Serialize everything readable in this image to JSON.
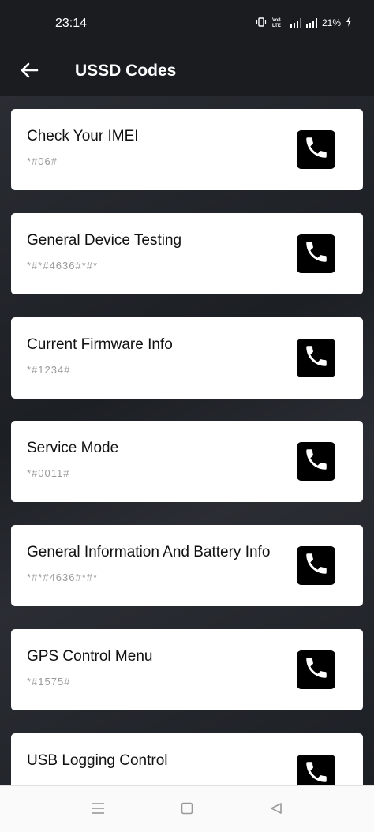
{
  "status_bar": {
    "time": "23:14",
    "volte_label": "Vo8\nLTE",
    "battery": "21%"
  },
  "app_bar": {
    "title": "USSD Codes",
    "back_icon": "arrow-left-icon"
  },
  "codes": [
    {
      "title": "Check Your IMEI",
      "code": "*#06#"
    },
    {
      "title": "General Device Testing",
      "code": "*#*#4636#*#*"
    },
    {
      "title": "Current Firmware Info",
      "code": "*#1234#"
    },
    {
      "title": "Service Mode",
      "code": "*#0011#"
    },
    {
      "title": "General Information And Battery Info",
      "code": "*#*#4636#*#*"
    },
    {
      "title": "GPS Control Menu",
      "code": "*#1575#"
    },
    {
      "title": "USB Logging Control",
      "code": ""
    }
  ],
  "icons": {
    "call": "phone-icon",
    "nav_menu": "menu-icon",
    "nav_home": "home-icon",
    "nav_back": "back-triangle-icon"
  },
  "colors": {
    "background": "#1f2227",
    "card": "#ffffff",
    "call_button": "#000000",
    "code_text": "#9a9a9a"
  }
}
